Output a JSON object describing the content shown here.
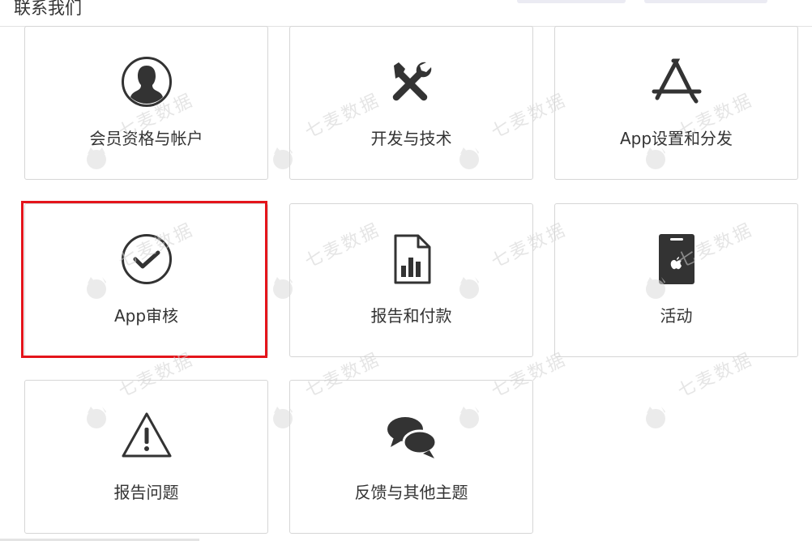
{
  "header": {
    "title": "联系我们"
  },
  "cards": [
    {
      "label": "会员资格与帐户",
      "icon": "user-icon"
    },
    {
      "label": "开发与技术",
      "icon": "tools-icon"
    },
    {
      "label": "App设置和分发",
      "icon": "app-store-icon"
    },
    {
      "label": "App审核",
      "icon": "checkmark-circle-icon",
      "highlighted": true
    },
    {
      "label": "报告和付款",
      "icon": "report-chart-icon"
    },
    {
      "label": "活动",
      "icon": "apple-badge-icon"
    },
    {
      "label": "报告问题",
      "icon": "warning-icon"
    },
    {
      "label": "反馈与其他主题",
      "icon": "chat-bubbles-icon"
    }
  ],
  "watermark": {
    "text": "七麦数据"
  },
  "colors": {
    "icon": "#333333",
    "highlight_border": "#e4141b",
    "card_border": "#d6d6d6"
  }
}
